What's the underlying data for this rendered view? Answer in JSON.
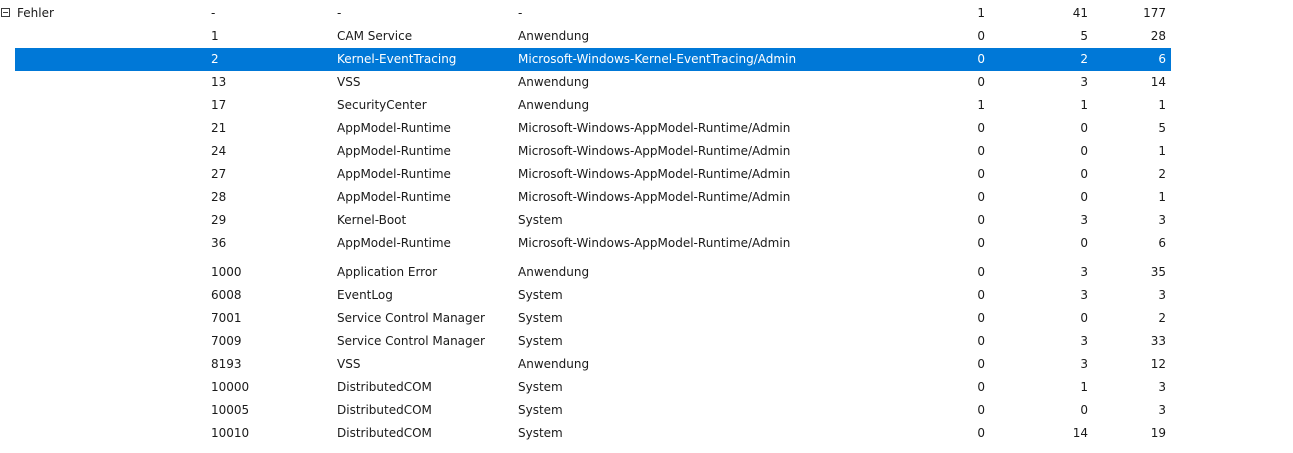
{
  "group": {
    "label": "Fehler",
    "id": "-",
    "source": "-",
    "log": "-",
    "n1": "1",
    "n2": "41",
    "n3": "177"
  },
  "rows": [
    {
      "id": "1",
      "source": "CAM Service",
      "log": "Anwendung",
      "n1": "0",
      "n2": "5",
      "n3": "28"
    },
    {
      "id": "2",
      "source": "Kernel-EventTracing",
      "log": "Microsoft-Windows-Kernel-EventTracing/Admin",
      "n1": "0",
      "n2": "2",
      "n3": "6"
    },
    {
      "id": "13",
      "source": "VSS",
      "log": "Anwendung",
      "n1": "0",
      "n2": "3",
      "n3": "14"
    },
    {
      "id": "17",
      "source": "SecurityCenter",
      "log": "Anwendung",
      "n1": "1",
      "n2": "1",
      "n3": "1"
    },
    {
      "id": "21",
      "source": "AppModel-Runtime",
      "log": "Microsoft-Windows-AppModel-Runtime/Admin",
      "n1": "0",
      "n2": "0",
      "n3": "5"
    },
    {
      "id": "24",
      "source": "AppModel-Runtime",
      "log": "Microsoft-Windows-AppModel-Runtime/Admin",
      "n1": "0",
      "n2": "0",
      "n3": "1"
    },
    {
      "id": "27",
      "source": "AppModel-Runtime",
      "log": "Microsoft-Windows-AppModel-Runtime/Admin",
      "n1": "0",
      "n2": "0",
      "n3": "2"
    },
    {
      "id": "28",
      "source": "AppModel-Runtime",
      "log": "Microsoft-Windows-AppModel-Runtime/Admin",
      "n1": "0",
      "n2": "0",
      "n3": "1"
    },
    {
      "id": "29",
      "source": "Kernel-Boot",
      "log": "System",
      "n1": "0",
      "n2": "3",
      "n3": "3"
    },
    {
      "id": "36",
      "source": "AppModel-Runtime",
      "log": "Microsoft-Windows-AppModel-Runtime/Admin",
      "n1": "0",
      "n2": "0",
      "n3": "6"
    },
    {
      "id": "1000",
      "source": "Application Error",
      "log": "Anwendung",
      "n1": "0",
      "n2": "3",
      "n3": "35"
    },
    {
      "id": "6008",
      "source": "EventLog",
      "log": "System",
      "n1": "0",
      "n2": "3",
      "n3": "3"
    },
    {
      "id": "7001",
      "source": "Service Control Manager",
      "log": "System",
      "n1": "0",
      "n2": "0",
      "n3": "2"
    },
    {
      "id": "7009",
      "source": "Service Control Manager",
      "log": "System",
      "n1": "0",
      "n2": "3",
      "n3": "33"
    },
    {
      "id": "8193",
      "source": "VSS",
      "log": "Anwendung",
      "n1": "0",
      "n2": "3",
      "n3": "12"
    },
    {
      "id": "10000",
      "source": "DistributedCOM",
      "log": "System",
      "n1": "0",
      "n2": "1",
      "n3": "3"
    },
    {
      "id": "10005",
      "source": "DistributedCOM",
      "log": "System",
      "n1": "0",
      "n2": "0",
      "n3": "3"
    },
    {
      "id": "10010",
      "source": "DistributedCOM",
      "log": "System",
      "n1": "0",
      "n2": "14",
      "n3": "19"
    }
  ],
  "selected_row": 1,
  "colors": {
    "selection": "#0078d7",
    "selection_text": "#ffffff",
    "text": "#1a1a1a"
  },
  "icons": {
    "expander": "collapse-minus-icon"
  }
}
